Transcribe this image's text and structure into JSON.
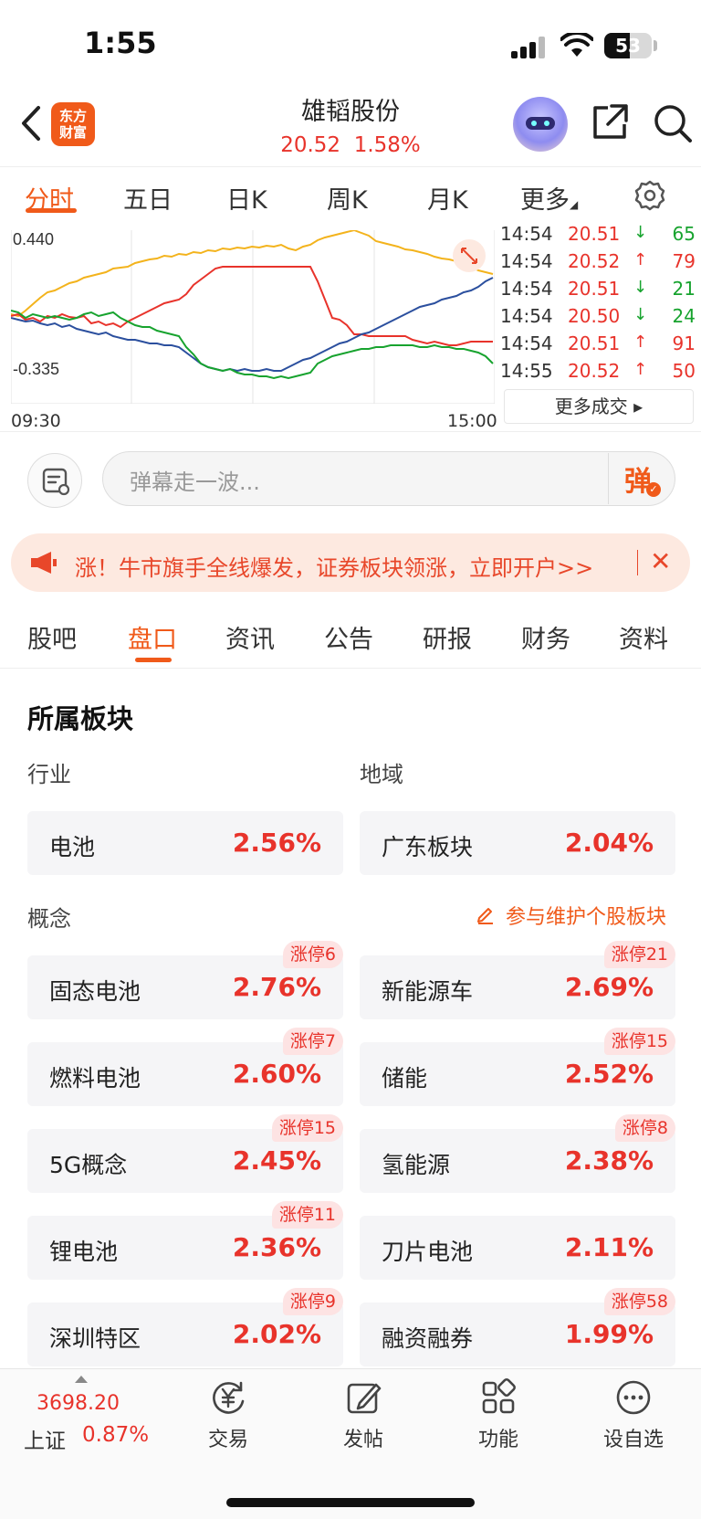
{
  "status": {
    "time": "1:55",
    "battery": "53"
  },
  "header": {
    "logo_line1": "东方",
    "logo_line2": "财富",
    "stock_name": "雄韬股份",
    "price": "20.52",
    "change_pct": "1.58%"
  },
  "chart_tabs": [
    "分时",
    "五日",
    "日K",
    "周K",
    "月K",
    "更多"
  ],
  "chart": {
    "y_top": "0.440",
    "y_bottom": "-0.335",
    "x_start": "09:30",
    "x_end": "15:00",
    "colors": {
      "yellow": "#f3b31c",
      "red": "#e8332b",
      "blue": "#2b4f9e",
      "green": "#17a32e"
    }
  },
  "trades": [
    {
      "time": "14:54",
      "price": "20.51",
      "dir": "down",
      "arrow": "↓",
      "vol": "65"
    },
    {
      "time": "14:54",
      "price": "20.52",
      "dir": "up",
      "arrow": "↑",
      "vol": "79"
    },
    {
      "time": "14:54",
      "price": "20.51",
      "dir": "down",
      "arrow": "↓",
      "vol": "21"
    },
    {
      "time": "14:54",
      "price": "20.50",
      "dir": "down",
      "arrow": "↓",
      "vol": "24"
    },
    {
      "time": "14:54",
      "price": "20.51",
      "dir": "up",
      "arrow": "↑",
      "vol": "91"
    },
    {
      "time": "14:55",
      "price": "20.52",
      "dir": "up",
      "arrow": "↑",
      "vol": "50"
    }
  ],
  "more_trades": "更多成交 ▸",
  "danmaku": {
    "placeholder": "弹幕走一波...",
    "send": "弹"
  },
  "promo": {
    "text": "涨！牛市旗手全线爆发，证券板块领涨，立即开户>>",
    "close": "✕"
  },
  "section_tabs": [
    "股吧",
    "盘口",
    "资讯",
    "公告",
    "研报",
    "财务",
    "资料"
  ],
  "sectors": {
    "title": "所属板块",
    "industry_label": "行业",
    "region_label": "地域",
    "concept_label": "概念",
    "maintain_link": "参与维护个股板块",
    "industry": {
      "name": "电池",
      "pct": "2.56%"
    },
    "region": {
      "name": "广东板块",
      "pct": "2.04%"
    },
    "concepts": [
      {
        "name": "固态电池",
        "pct": "2.76%",
        "badge": "涨停6"
      },
      {
        "name": "新能源车",
        "pct": "2.69%",
        "badge": "涨停21"
      },
      {
        "name": "燃料电池",
        "pct": "2.60%",
        "badge": "涨停7"
      },
      {
        "name": "储能",
        "pct": "2.52%",
        "badge": "涨停15"
      },
      {
        "name": "5G概念",
        "pct": "2.45%",
        "badge": "涨停15"
      },
      {
        "name": "氢能源",
        "pct": "2.38%",
        "badge": "涨停8"
      },
      {
        "name": "锂电池",
        "pct": "2.36%",
        "badge": "涨停11"
      },
      {
        "name": "刀片电池",
        "pct": "2.11%",
        "badge": ""
      },
      {
        "name": "深圳特区",
        "pct": "2.02%",
        "badge": "涨停9"
      },
      {
        "name": "融资融券",
        "pct": "1.99%",
        "badge": "涨停58"
      }
    ]
  },
  "bottom_bar": {
    "index_value": "3698.20",
    "index_name": "上证",
    "index_pct": "0.87%",
    "items": [
      "交易",
      "发帖",
      "功能",
      "设自选"
    ]
  }
}
